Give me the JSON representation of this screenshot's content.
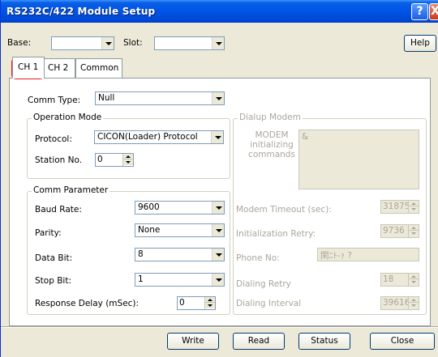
{
  "window": {
    "title": "RS232C/422 Module Setup",
    "help_glyph": "?",
    "close_glyph": "X"
  },
  "header": {
    "base_label": "Base:",
    "base_value": "",
    "slot_label": "Slot:",
    "slot_value": "",
    "help_button": "Help"
  },
  "tabs": [
    {
      "label": "CH 1",
      "active": true
    },
    {
      "label": "CH 2",
      "active": false
    },
    {
      "label": "Common",
      "active": false
    }
  ],
  "comm_type": {
    "label": "Comm Type:",
    "value": "Null"
  },
  "operation_mode": {
    "title": "Operation Mode",
    "protocol_label": "Protocol:",
    "protocol_value": "CICON(Loader) Protocol",
    "station_label": "Station No.",
    "station_value": "0"
  },
  "comm_parameter": {
    "title": "Comm Parameter",
    "baud_label": "Baud Rate:",
    "baud_value": "9600",
    "parity_label": "Parity:",
    "parity_value": "None",
    "databit_label": "Data Bit:",
    "databit_value": "8",
    "stopbit_label": "Stop Bit:",
    "stopbit_value": "1",
    "delay_label": "Response Delay (mSec):",
    "delay_value": "0"
  },
  "dialup_modem": {
    "title": "Dialup Modem",
    "init_label_1": "MODEM",
    "init_label_2": "initializing",
    "init_label_3": "commands",
    "init_value": "&",
    "timeout_label": "Modem Timeout (sec):",
    "timeout_value": "31875",
    "init_retry_label": "Initialization Retry:",
    "init_retry_value": "9736",
    "phone_label": "Phone No:",
    "phone_value": "閑ﾆﾄ-ｧ ?",
    "dial_retry_label": "Dialing Retry",
    "dial_retry_value": "18",
    "dial_interval_label": "Dialing Interval",
    "dial_interval_value": "39616"
  },
  "footer": {
    "write": "Write",
    "read": "Read",
    "status": "Status",
    "close": "Close"
  },
  "colors": {
    "titlebar": "#0055e5",
    "highlight": "#e02020",
    "disabled_text": "#a9a69b"
  }
}
